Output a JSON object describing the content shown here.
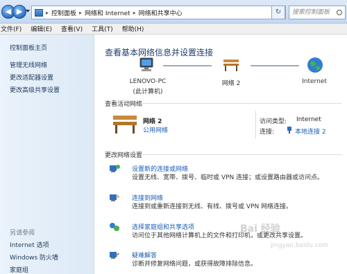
{
  "address_bar": {
    "breadcrumbs": [
      "控制面板",
      "网络和 Internet",
      "网络和共享中心"
    ],
    "search_placeholder": "搜索控制面板"
  },
  "menu": [
    "文件(F)",
    "编辑(E)",
    "查看(V)",
    "工具(T)",
    "帮助(H)"
  ],
  "sidebar": {
    "items": [
      "控制面板主页",
      "管理无线网络",
      "更改适配器设置",
      "更改高级共享设置"
    ],
    "see_also_header": "另请参阅",
    "see_also": [
      "Internet 选项",
      "Windows 防火墙",
      "家庭组"
    ]
  },
  "main": {
    "title": "查看基本网络信息并设置连接",
    "map": {
      "computer_name": "LENOVO-PC",
      "computer_sub": "(此计算机)",
      "network": "网络 2",
      "internet": "Internet"
    },
    "active_header": "查看活动网络",
    "active": {
      "name": "网络 2",
      "type": "公用网络",
      "access_label": "访问类型:",
      "access_value": "Internet",
      "conn_label": "连接:",
      "conn_value": "本地连接 2"
    },
    "change_header": "更改网络设置",
    "tasks": [
      {
        "title": "设置新的连接或网络",
        "desc": "设置无线、宽带、拨号、临时或 VPN 连接；或设置路由器或访问点。"
      },
      {
        "title": "连接到网络",
        "desc": "连接到或重新连接到无线、有线、拨号或 VPN 网络连接。"
      },
      {
        "title": "选择家庭组和共享选项",
        "desc": "访问位于其他网络计算机上的文件和打印机，或更改共享设置。"
      },
      {
        "title": "疑难解答",
        "desc": "诊断并修复网络问题，或获得故障排除信息。"
      }
    ]
  },
  "watermark": {
    "brand": "Bai 经验",
    "url": "jingyan.baidu.com"
  }
}
